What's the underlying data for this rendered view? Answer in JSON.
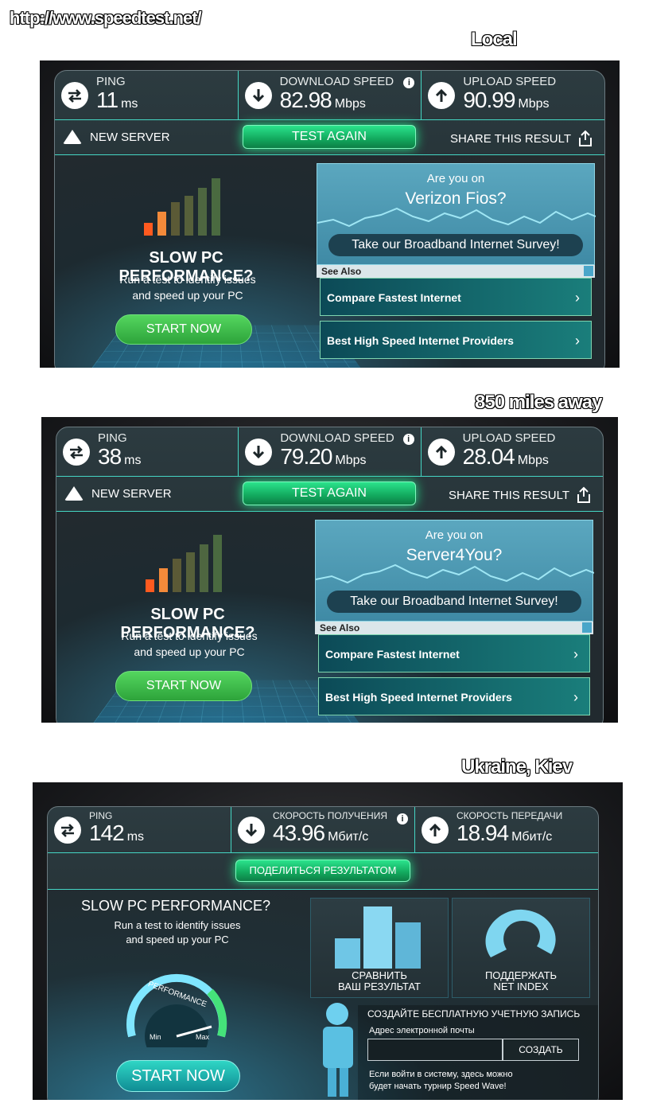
{
  "url": "http://www.speedtest.net/",
  "panels": [
    {
      "label": "Local",
      "ping_label": "PING",
      "ping_value": "11",
      "ping_unit": "ms",
      "download_label": "DOWNLOAD SPEED",
      "download_value": "82.98",
      "download_unit": "Mbps",
      "upload_label": "UPLOAD SPEED",
      "upload_value": "90.99",
      "upload_unit": "Mbps",
      "new_server": "NEW SERVER",
      "test_again": "TEST AGAIN",
      "share": "SHARE THIS RESULT",
      "slow_title": "SLOW PC PERFORMANCE?",
      "slow_sub_1": "Run a test to identify issues",
      "slow_sub_2": "and speed up your PC",
      "start": "START NOW",
      "ad_q1": "Are you on",
      "ad_q2": "Verizon Fios?",
      "survey": "Take our Broadband Internet Survey!",
      "see_also": "See Also",
      "link1": "Compare Fastest Internet",
      "link2": "Best High Speed Internet Providers"
    },
    {
      "label": "850 miles away",
      "ping_label": "PING",
      "ping_value": "38",
      "ping_unit": "ms",
      "download_label": "DOWNLOAD SPEED",
      "download_value": "79.20",
      "download_unit": "Mbps",
      "upload_label": "UPLOAD SPEED",
      "upload_value": "28.04",
      "upload_unit": "Mbps",
      "new_server": "NEW SERVER",
      "test_again": "TEST AGAIN",
      "share": "SHARE THIS RESULT",
      "slow_title": "SLOW PC PERFORMANCE?",
      "slow_sub_1": "Run a test to identify issues",
      "slow_sub_2": "and speed up your PC",
      "start": "START NOW",
      "ad_q1": "Are you on",
      "ad_q2": "Server4You?",
      "survey": "Take our Broadband Internet Survey!",
      "see_also": "See Also",
      "link1": "Compare Fastest Internet",
      "link2": "Best High Speed Internet Providers"
    }
  ],
  "kiev": {
    "label": "Ukraine, Kiev",
    "ping_label": "PING",
    "ping_value": "142",
    "ping_unit": "ms",
    "download_label": "СКОРОСТЬ ПОЛУЧЕНИЯ",
    "download_value": "43.96",
    "download_unit": "Мбит/с",
    "upload_label": "СКОРОСТЬ ПЕРЕДАЧИ",
    "upload_value": "18.94",
    "upload_unit": "Мбит/с",
    "share": "ПОДЕЛИТЬСЯ РЕЗУЛЬТАТОМ",
    "slow_title": "SLOW PC PERFORMANCE?",
    "slow_sub_1": "Run a test to identify issues",
    "slow_sub_2": "and speed up your PC",
    "gauge_label": "PERFORMANCE",
    "gauge_min": "Min",
    "gauge_max": "Max",
    "start": "START NOW",
    "tile1_1": "СРАВНИТЬ",
    "tile1_2": "ВАШ РЕЗУЛЬТАТ",
    "tile2_1": "ПОДДЕРЖАТЬ",
    "tile2_2": "NET INDEX",
    "signup_heading": "СОЗДАЙТЕ БЕСПЛАТНУЮ УЧЕТНУЮ ЗАПИСЬ",
    "email_label": "Адрес электронной почты",
    "create": "СОЗДАТЬ",
    "note_1": "Если войти в систему, здесь можно",
    "note_2": "будет начать турнир Speed Wave!"
  },
  "colors": {
    "accent_teal": "#45d6c4",
    "button_green": "#12a85d",
    "bar_orange": "#ff5a1f"
  }
}
